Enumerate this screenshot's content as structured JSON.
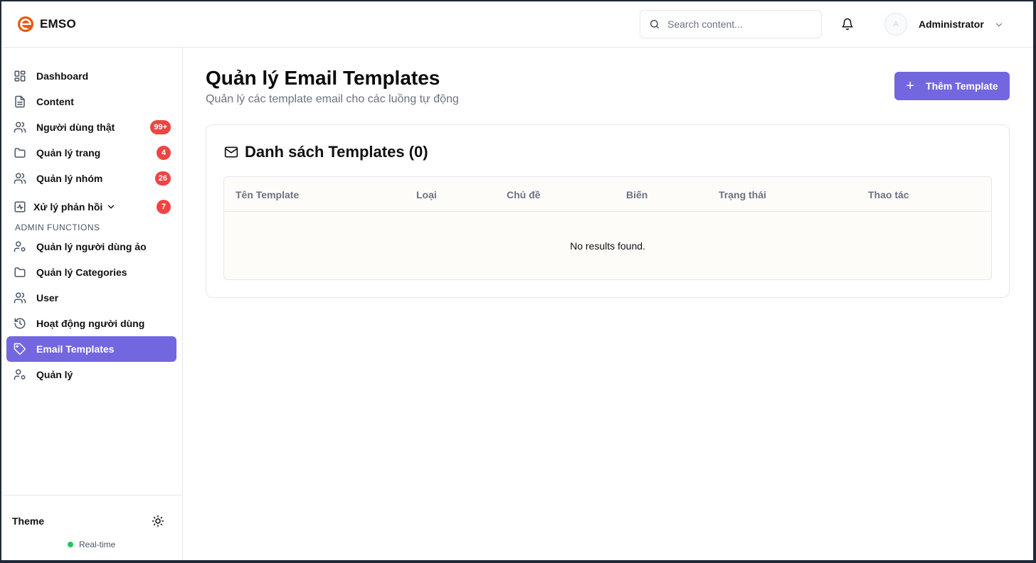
{
  "header": {
    "brand": "EMSO",
    "search_placeholder": "Search content...",
    "user_name": "Administrator",
    "avatar_letter": "A"
  },
  "sidebar": {
    "items": [
      {
        "label": "Dashboard",
        "icon": "grid-icon"
      },
      {
        "label": "Content",
        "icon": "file-text-icon"
      },
      {
        "label": "Người dùng thật",
        "icon": "users-icon",
        "badge": "99+"
      },
      {
        "label": "Quản lý trang",
        "icon": "folder-icon",
        "badge": "4"
      },
      {
        "label": "Quản lý nhóm",
        "icon": "users-icon",
        "badge": "26"
      },
      {
        "label": "Xử lý phản hồi",
        "icon": "activity-icon",
        "badge": "7"
      }
    ],
    "section_label": "ADMIN FUNCTIONS",
    "admin_items": [
      {
        "label": "Quản lý người dùng ảo",
        "icon": "user-cog-icon"
      },
      {
        "label": "Quản lý Categories",
        "icon": "folder-icon"
      },
      {
        "label": "User",
        "icon": "users-icon"
      },
      {
        "label": "Hoạt động người dùng",
        "icon": "history-icon"
      },
      {
        "label": "Email Templates",
        "icon": "tag-icon",
        "active": true
      },
      {
        "label": "Quản lý",
        "icon": "user-cog-icon"
      }
    ],
    "theme_label": "Theme",
    "realtime_label": "Real-time"
  },
  "main": {
    "title": "Quản lý Email Templates",
    "subtitle": "Quản lý các template email cho các luồng tự động",
    "add_button": "Thêm Template",
    "card_title": "Danh sách Templates (0)",
    "table": {
      "columns": [
        "Tên Template",
        "Loại",
        "Chủ đề",
        "Biến",
        "Trạng thái",
        "Thao tác"
      ],
      "rows": [],
      "empty_text": "No results found."
    }
  },
  "colors": {
    "accent": "#7367e0",
    "badge": "#ef4444",
    "logo": "#ea580c",
    "status_online": "#22c55e"
  }
}
